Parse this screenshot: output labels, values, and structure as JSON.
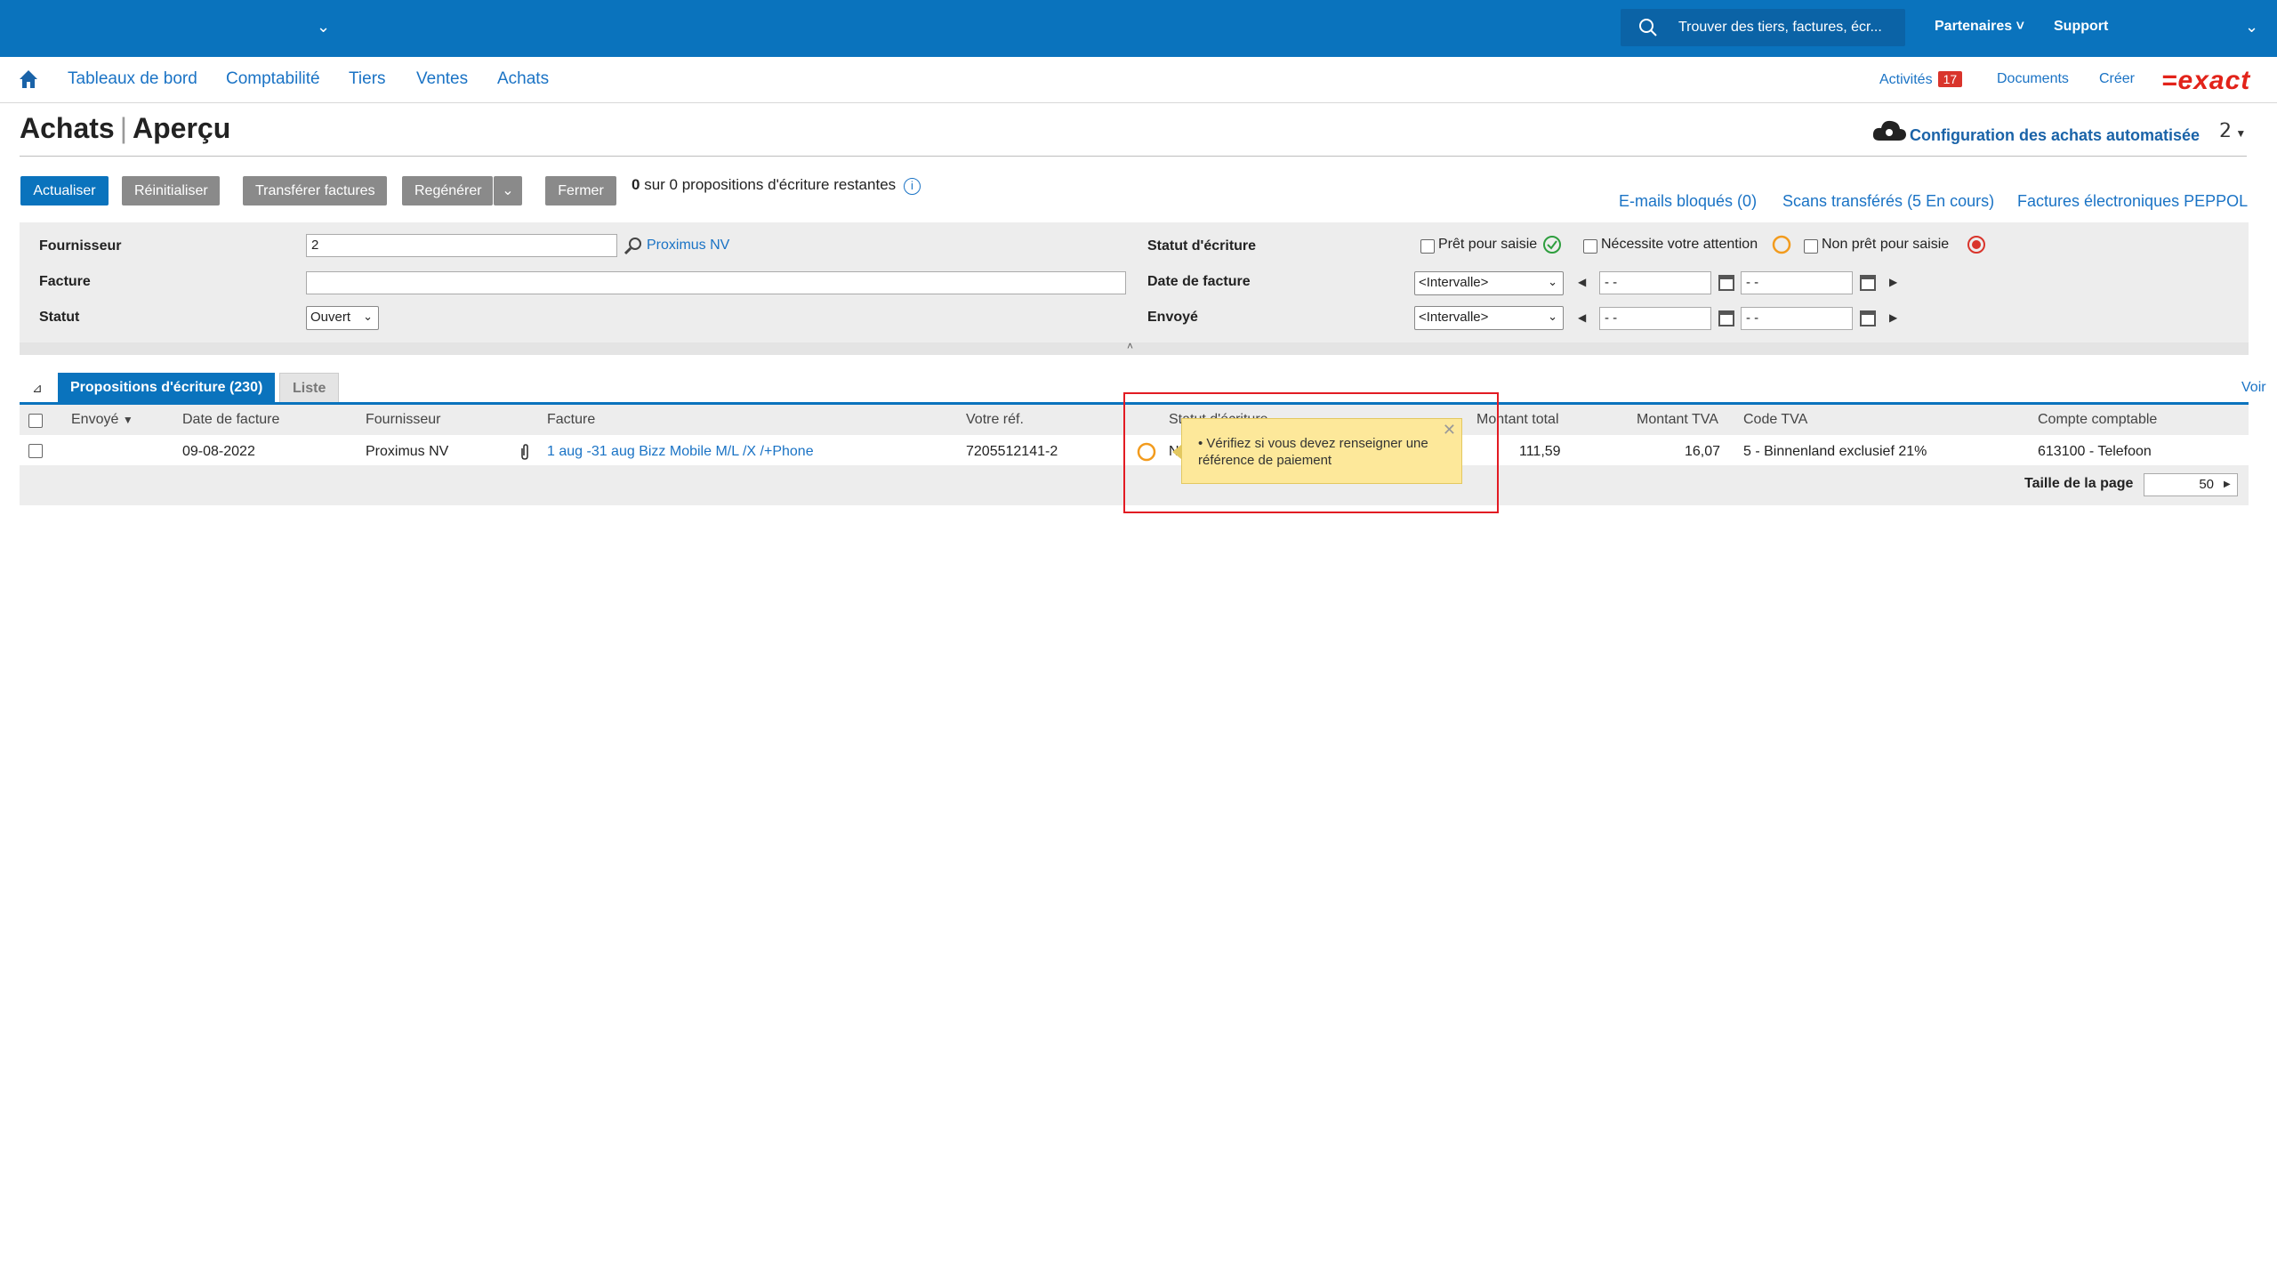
{
  "topbar": {
    "search_placeholder": "Trouver des tiers, factures, écr...",
    "partners": "Partenaires",
    "support": "Support"
  },
  "nav": {
    "items": [
      "Tableaux de bord",
      "Comptabilité",
      "Tiers",
      "Ventes",
      "Achats"
    ],
    "activities": "Activités",
    "activities_count": "17",
    "documents": "Documents",
    "create": "Créer",
    "logo": "=exact"
  },
  "page": {
    "title_left": "Achats",
    "title_right": "Aperçu",
    "config_link": "Configuration des achats automatisée"
  },
  "toolbar": {
    "refresh": "Actualiser",
    "reset": "Réinitialiser",
    "transfer": "Transférer factures",
    "regenerate": "Regénérer",
    "close": "Fermer",
    "remaining_count": "0",
    "remaining_text": "sur 0 propositions d'écriture restantes"
  },
  "links": {
    "blocked_emails": "E-mails bloqués (0)",
    "scans": "Scans transférés (5 En cours)",
    "peppol": "Factures électroniques PEPPOL"
  },
  "filter": {
    "supplier_label": "Fournisseur",
    "supplier_value": "2",
    "supplier_name": "Proximus NV",
    "invoice_label": "Facture",
    "status_label": "Statut",
    "status_value": "Ouvert",
    "entry_status_label": "Statut d'écriture",
    "ready": "Prêt pour saisie",
    "attention": "Nécessite votre attention",
    "not_ready": "Non prêt pour saisie",
    "invoice_date_label": "Date de facture",
    "sent_label": "Envoyé",
    "interval": "<Intervalle>",
    "date_placeholder": "- -"
  },
  "tabs": {
    "proposals": "Propositions d'écriture (230)",
    "list": "Liste",
    "view": "Voir"
  },
  "table": {
    "columns": [
      "Envoyé",
      "Date de facture",
      "Fournisseur",
      "Facture",
      "Votre réf.",
      "Statut d'écriture",
      "Montant total",
      "Montant TVA",
      "Code TVA",
      "Compte comptable"
    ],
    "rows": [
      {
        "date": "09-08-2022",
        "supplier": "Proximus NV",
        "invoice": "1 aug -31 aug Bizz Mobile M/L /X /+Phone",
        "ref": "7205512141-2",
        "status_fragment": "N",
        "total": "111,59",
        "vat": "16,07",
        "vat_code": "5 - Binnenland exclusief 21%",
        "account": "613100 - Telefoon"
      }
    ],
    "page_size_label": "Taille de la page",
    "page_size": "50"
  },
  "tooltip": {
    "text": "• Vérifiez si vous devez renseigner une référence de paiement"
  },
  "colors": {
    "primary": "#0a73bd",
    "ready": "#2e9e3e",
    "attention": "#f29b1d",
    "not_ready": "#d9342b"
  }
}
